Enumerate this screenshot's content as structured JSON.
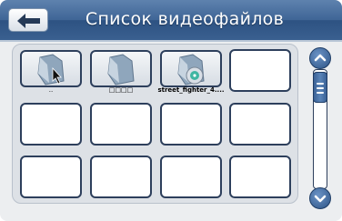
{
  "header": {
    "title": "Список видеофайлов",
    "back_icon": "back-arrow-icon"
  },
  "files": [
    {
      "label": "..",
      "icon": "folder-up-icon",
      "bold": false
    },
    {
      "label": "□□□□",
      "icon": "folder-icon",
      "bold": false
    },
    {
      "label": "street_fighter_4....",
      "icon": "video-file-icon",
      "bold": true
    }
  ],
  "empty_slots": 9,
  "scrollbar": {
    "up_icon": "chevron-up-icon",
    "down_icon": "chevron-down-icon",
    "position": 0
  },
  "colors": {
    "header": "#3f6596",
    "accent": "#2d5486",
    "tile_border": "#2d3f5c"
  }
}
